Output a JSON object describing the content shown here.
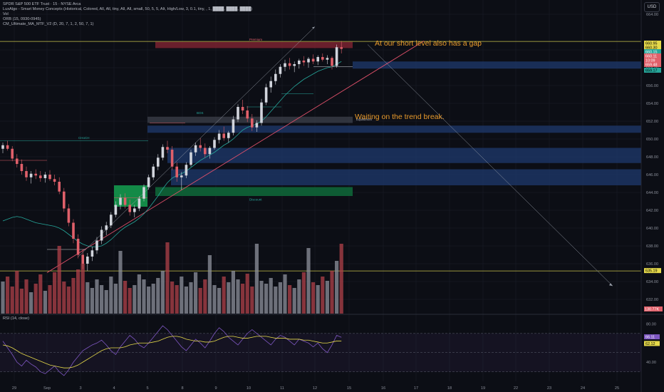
{
  "header": {
    "symbol_line": "SPDR S&P 500 ETF Trust · 15 · NYSE Arca",
    "indicators": [
      "LuxAlgo - Smart Money Concepts (Historical, Colored, All, All, tiny, All, All, small, 50, 5, 5, Alt, High/Low, 3, 0.1, tiny, , 1, ████, ████, ████)",
      "Vol",
      "ORB (15, 0930-0945)",
      "CM_Ultimate_MA_MTF_V2 (D, 20, 7, 1, 2, 50, 7, 1)"
    ],
    "currency": "USD"
  },
  "annotations": {
    "gap_note": "At our short level also has a gap",
    "trend_note": "Waiting on the trend break."
  },
  "zone_labels": {
    "premium": "Premium",
    "equilibrium": "Equilibrium",
    "discount": "Discount",
    "strong_low": "Strong Low",
    "weak_high": "Weak High",
    "choch": "CHoCH",
    "bos": "BOS"
  },
  "colors": {
    "background": "#0c0e15",
    "grid": "#1b1e28",
    "candle_up": "#d1d4dc",
    "candle_down": "#e0606a",
    "annotation": "#e89a2c",
    "trendline": "#e0506a",
    "demand_zone": "#1e3a6e",
    "premium_zone": "#7a2230",
    "discount_zone": "#0f6a3a",
    "level_line": "#c8c24a",
    "volume_up": "#8e929c",
    "volume_down": "#b0414a",
    "rsi": "#7e57c2",
    "rsi_ma": "#e5d94a"
  },
  "chart_data": [
    {
      "type": "candlestick",
      "title": "SPDR S&P 500 ETF Trust · 15 · NYSE Arca",
      "x_ticks": [
        "29",
        "Sep",
        "3",
        "4",
        "5",
        "8",
        "9",
        "10",
        "11",
        "12",
        "15",
        "16",
        "17",
        "18",
        "19",
        "22",
        "23",
        "24",
        "25"
      ],
      "y_ticks": [
        632,
        634,
        636,
        638,
        640,
        642,
        644,
        646,
        648,
        650,
        652,
        654,
        656,
        658,
        660,
        664
      ],
      "ylim": [
        630.4,
        665.6
      ],
      "price_tags": [
        {
          "value": "660.95",
          "kind": "level"
        },
        {
          "value": "660.30",
          "kind": "ma"
        },
        {
          "value": "660.15",
          "kind": "orb"
        },
        {
          "value": "660.11",
          "kind": "last"
        },
        {
          "value": "10:09",
          "kind": "countdown"
        },
        {
          "value": "659.48",
          "kind": "low"
        },
        {
          "value": "659.17",
          "kind": "ma2"
        },
        {
          "value": "635.19",
          "kind": "level"
        },
        {
          "value": "130.77K",
          "kind": "volume"
        }
      ],
      "levels": [
        660.95,
        635.19
      ],
      "zones": {
        "premium": [
          660.2,
          660.9
        ],
        "equilibrium": [
          651.8,
          652.5
        ],
        "discount": [
          643.6,
          644.6
        ],
        "demand": [
          [
            657.9,
            658.7
          ],
          [
            650.7,
            651.5
          ],
          [
            647.3,
            649.0
          ],
          [
            644.8,
            646.6
          ]
        ]
      },
      "trendline": {
        "start": [
          "Sep 2",
          635.0
        ],
        "end": [
          "Sep 16",
          660.4
        ]
      },
      "projection_arrow": {
        "start": [
          "Sep 15",
          660.6
        ],
        "end": [
          "Sep 25",
          633.5
        ]
      },
      "upper_arrow": {
        "start": [
          "Sep 3",
          636.5
        ],
        "end": [
          "Sep 12",
          662.2
        ]
      },
      "ohlc": [
        [
          648.9,
          649.6,
          648.4,
          649.3
        ],
        [
          649.3,
          649.8,
          648.7,
          648.9
        ],
        [
          648.9,
          649.2,
          647.5,
          647.8
        ],
        [
          647.8,
          648.3,
          646.8,
          647.2
        ],
        [
          647.2,
          647.7,
          646.0,
          646.4
        ],
        [
          646.4,
          646.9,
          645.3,
          645.7
        ],
        [
          645.7,
          646.4,
          645.0,
          646.1
        ],
        [
          646.1,
          646.6,
          645.5,
          645.9
        ],
        [
          645.9,
          646.4,
          645.2,
          645.6
        ],
        [
          645.6,
          646.3,
          645.1,
          646.0
        ],
        [
          646.0,
          646.5,
          645.3,
          645.5
        ],
        [
          645.5,
          646.0,
          644.8,
          645.2
        ],
        [
          645.2,
          645.7,
          643.8,
          644.1
        ],
        [
          644.1,
          644.5,
          641.8,
          642.2
        ],
        [
          642.2,
          642.7,
          640.2,
          640.6
        ],
        [
          640.6,
          641.0,
          638.3,
          638.8
        ],
        [
          638.8,
          639.3,
          636.6,
          637.0
        ],
        [
          637.0,
          637.6,
          635.4,
          636.0
        ],
        [
          636.0,
          637.2,
          635.2,
          636.8
        ],
        [
          636.8,
          637.9,
          636.3,
          637.5
        ],
        [
          637.5,
          639.0,
          637.1,
          638.6
        ],
        [
          638.6,
          640.2,
          638.2,
          639.8
        ],
        [
          639.8,
          640.7,
          639.2,
          640.3
        ],
        [
          640.3,
          641.8,
          640.0,
          641.5
        ],
        [
          641.5,
          643.0,
          641.2,
          642.6
        ],
        [
          642.6,
          643.8,
          642.1,
          643.4
        ],
        [
          643.4,
          643.9,
          642.2,
          642.6
        ],
        [
          642.6,
          643.2,
          641.4,
          641.8
        ],
        [
          641.8,
          642.6,
          641.2,
          642.2
        ],
        [
          642.2,
          643.6,
          641.9,
          643.3
        ],
        [
          643.3,
          644.9,
          643.0,
          644.6
        ],
        [
          644.6,
          646.0,
          644.3,
          645.7
        ],
        [
          645.7,
          647.2,
          645.4,
          646.9
        ],
        [
          646.9,
          648.3,
          646.5,
          647.9
        ],
        [
          647.9,
          649.4,
          647.6,
          649.1
        ],
        [
          649.1,
          649.8,
          648.4,
          648.8
        ],
        [
          648.8,
          649.2,
          646.5,
          646.9
        ],
        [
          646.9,
          647.4,
          645.2,
          645.7
        ],
        [
          645.7,
          646.3,
          644.3,
          645.9
        ],
        [
          645.9,
          647.4,
          645.6,
          647.1
        ],
        [
          647.1,
          648.8,
          646.9,
          648.5
        ],
        [
          648.5,
          649.6,
          648.1,
          649.3
        ],
        [
          649.3,
          650.1,
          648.6,
          649.0
        ],
        [
          649.0,
          649.5,
          647.9,
          648.3
        ],
        [
          648.3,
          649.2,
          647.8,
          649.0
        ],
        [
          649.0,
          650.2,
          648.8,
          649.9
        ],
        [
          649.9,
          651.0,
          649.5,
          650.6
        ],
        [
          650.6,
          651.4,
          649.8,
          650.1
        ],
        [
          650.1,
          650.9,
          649.6,
          650.7
        ],
        [
          650.7,
          652.6,
          650.4,
          652.2
        ],
        [
          652.2,
          653.9,
          651.9,
          653.6
        ],
        [
          653.6,
          654.4,
          652.8,
          653.2
        ],
        [
          653.2,
          653.7,
          651.9,
          652.3
        ],
        [
          652.3,
          652.8,
          650.9,
          651.3
        ],
        [
          651.3,
          652.1,
          650.8,
          651.8
        ],
        [
          651.8,
          654.5,
          651.5,
          654.1
        ],
        [
          654.1,
          656.2,
          653.8,
          655.8
        ],
        [
          655.8,
          657.0,
          655.2,
          656.5
        ],
        [
          656.5,
          657.8,
          656.1,
          657.3
        ],
        [
          657.3,
          658.4,
          656.9,
          658.1
        ],
        [
          658.1,
          658.9,
          657.6,
          658.5
        ],
        [
          658.5,
          659.1,
          657.8,
          658.2
        ],
        [
          658.2,
          658.7,
          657.5,
          658.4
        ],
        [
          658.4,
          659.0,
          657.9,
          658.8
        ],
        [
          658.8,
          659.3,
          658.2,
          658.6
        ],
        [
          658.6,
          659.2,
          658.0,
          659.0
        ],
        [
          659.0,
          659.5,
          658.4,
          658.7
        ],
        [
          658.7,
          659.4,
          658.3,
          659.2
        ],
        [
          659.2,
          659.6,
          658.7,
          658.9
        ],
        [
          658.9,
          659.4,
          658.4,
          659.1
        ],
        [
          659.1,
          659.3,
          657.8,
          658.2
        ],
        [
          658.2,
          660.6,
          658.0,
          660.3
        ],
        [
          660.3,
          661.0,
          659.6,
          660.11
        ]
      ],
      "ma_line": [
        640.8,
        641.0,
        641.2,
        641.3,
        641.2,
        641.0,
        640.8,
        640.6,
        640.5,
        640.4,
        640.3,
        640.2,
        640.0,
        639.7,
        639.3,
        638.9,
        638.5,
        638.2,
        638.0,
        637.9,
        637.9,
        638.0,
        638.3,
        638.7,
        639.2,
        639.7,
        640.1,
        640.4,
        640.7,
        641.1,
        641.6,
        642.2,
        642.9,
        643.6,
        644.4,
        645.1,
        645.6,
        645.9,
        646.1,
        646.4,
        646.8,
        647.2,
        647.6,
        647.9,
        648.2,
        648.5,
        648.9,
        649.3,
        649.6,
        650.0,
        650.5,
        651.0,
        651.3,
        651.5,
        651.7,
        652.0,
        652.5,
        653.1,
        653.7,
        654.3,
        654.9,
        655.4,
        655.9,
        656.3,
        656.7,
        657.0,
        657.3,
        657.6,
        657.8,
        658.0,
        658.1,
        658.4,
        658.7
      ],
      "volume": [
        0.45,
        0.52,
        0.38,
        0.6,
        0.35,
        0.48,
        0.3,
        0.42,
        0.55,
        0.32,
        0.4,
        0.58,
        0.95,
        0.45,
        0.38,
        0.5,
        0.62,
        0.7,
        0.44,
        0.36,
        0.48,
        0.4,
        0.33,
        0.52,
        0.42,
        0.88,
        0.46,
        0.36,
        0.4,
        0.55,
        0.48,
        0.38,
        0.42,
        0.5,
        0.6,
        1.0,
        0.45,
        0.4,
        0.52,
        0.38,
        0.44,
        0.58,
        0.36,
        0.48,
        0.82,
        0.4,
        0.36,
        0.52,
        0.44,
        0.6,
        0.48,
        0.42,
        0.56,
        0.38,
        0.98,
        0.46,
        0.42,
        0.5,
        0.38,
        0.44,
        0.55,
        0.4,
        0.36,
        0.48,
        0.58,
        0.92,
        0.44,
        0.4,
        0.52,
        0.46,
        0.6,
        0.74,
        0.98
      ],
      "rsi": [
        62,
        55,
        48,
        40,
        36,
        42,
        38,
        35,
        30,
        28,
        32,
        36,
        30,
        26,
        32,
        40,
        46,
        52,
        55,
        58,
        60,
        63,
        58,
        52,
        48,
        56,
        62,
        68,
        64,
        58,
        55,
        60,
        66,
        72,
        78,
        74,
        68,
        62,
        56,
        52,
        58,
        64,
        60,
        55,
        62,
        70,
        76,
        72,
        66,
        62,
        58,
        64,
        70,
        74,
        70,
        66,
        62,
        58,
        64,
        68,
        66,
        62,
        58,
        64,
        62,
        60,
        56,
        60,
        54,
        50,
        58,
        68,
        66
      ],
      "rsi_ma": [
        58,
        57,
        55,
        52,
        49,
        47,
        45,
        43,
        41,
        39,
        37,
        36,
        35,
        34,
        34,
        35,
        37,
        40,
        43,
        46,
        49,
        52,
        54,
        55,
        55,
        55,
        56,
        58,
        59,
        60,
        60,
        60,
        61,
        62,
        64,
        66,
        67,
        67,
        66,
        64,
        63,
        62,
        62,
        61,
        61,
        62,
        64,
        66,
        67,
        67,
        66,
        65,
        65,
        66,
        67,
        67,
        67,
        66,
        65,
        65,
        65,
        64,
        64,
        64,
        63,
        63,
        62,
        61,
        60,
        60,
        61,
        62.12,
        62.12
      ],
      "rsi_tags": [
        {
          "value": "66.11"
        },
        {
          "value": "62.12"
        }
      ],
      "rsi_ticks": [
        80.0,
        60.0,
        40.0
      ],
      "rsi_title": "RSI (14, close)"
    }
  ]
}
